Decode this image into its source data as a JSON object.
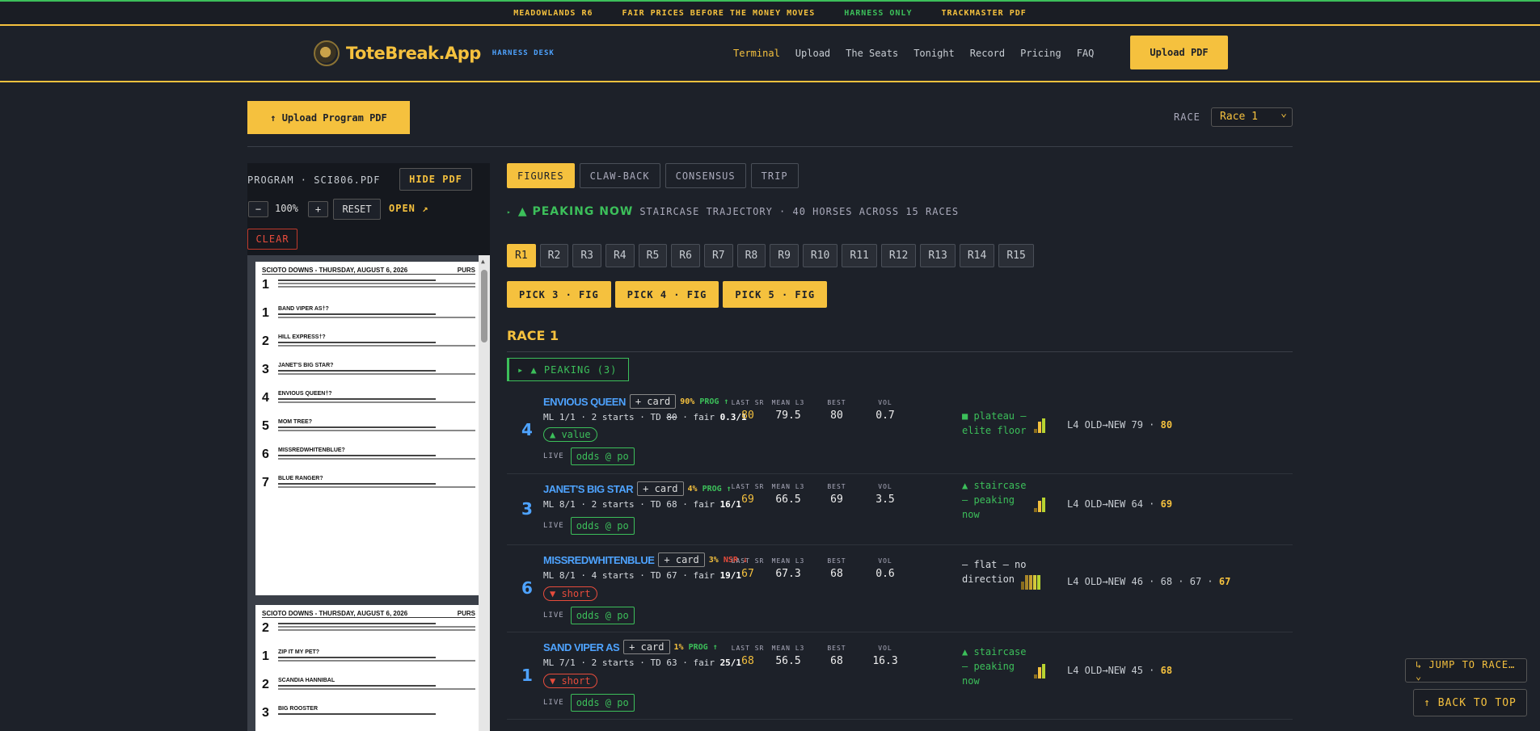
{
  "ticker": [
    "MEADOWLANDS R6",
    "FAIR PRICES BEFORE THE MONEY MOVES",
    "HARNESS ONLY",
    "TRACKMASTER PDF"
  ],
  "brand": {
    "name": "ToteBreak.App",
    "sub": "HARNESS DESK"
  },
  "nav": [
    "Terminal",
    "Upload",
    "The Seats",
    "Tonight",
    "Record",
    "Pricing",
    "FAQ"
  ],
  "upload_pdf": "Upload PDF",
  "upload_program": "↑ Upload Program PDF",
  "race_label": "RACE",
  "race_select": "Race 1",
  "pdf": {
    "title": "PROGRAM · SCI806.PDF",
    "hide": "HIDE PDF",
    "minus": "−",
    "zoom": "100%",
    "plus": "+",
    "reset": "RESET",
    "open": "OPEN ↗",
    "clear": "CLEAR",
    "page1_header": "SCIOTO DOWNS - THURSDAY, AUGUST 6, 2026",
    "page1_corner": "PURS",
    "page1_horses": [
      "BAND VIPER AS†?",
      "HILL EXPRESS†?",
      "JANET'S BIG STAR?",
      "ENVIOUS QUEEN†?",
      "MOM TREE?",
      "MISSREDWHITENBLUE?",
      "BLUE RANGER?"
    ],
    "page2_header": "SCIOTO DOWNS - THURSDAY, AUGUST 6, 2026",
    "page2_horses": [
      "ZIP IT MY PET?",
      "SCANDIA HANNIBAL",
      "BIG ROOSTER"
    ]
  },
  "tabs": [
    "FIGURES",
    "CLAW-BACK",
    "CONSENSUS",
    "TRIP"
  ],
  "peak_line": {
    "arrow": "▸",
    "label": "▲ PEAKING NOW",
    "desc": "STAIRCASE TRAJECTORY · 40 HORSES ACROSS 15 RACES"
  },
  "race_tabs": [
    "R1",
    "R2",
    "R3",
    "R4",
    "R5",
    "R6",
    "R7",
    "R8",
    "R9",
    "R10",
    "R11",
    "R12",
    "R13",
    "R14",
    "R15"
  ],
  "picks": [
    "PICK 3 · FIG",
    "PICK 4 · FIG",
    "PICK 5 · FIG"
  ],
  "race_title": "RACE 1",
  "peaking_group": "▸ ▲ PEAKING (3)",
  "stat_labels": {
    "last": "LAST SR",
    "mean": "MEAN L3",
    "best": "BEST",
    "vol": "VOL"
  },
  "live_label": "LIVE",
  "horses": [
    {
      "pp": "4",
      "name": "ENVIOUS QUEEN",
      "card": "+ card",
      "pct": "90%",
      "dir": "PROG ↑",
      "dir_color": "#3cbf5a",
      "ml_a": "ML 1/1 · 2 starts · TD ",
      "td": "80",
      "ml_b": " · fair ",
      "fair": "0.3/1",
      "badge": "▲ value",
      "badge_type": "v",
      "odds": "odds @ po",
      "last": "80",
      "mean": "79.5",
      "best": "80",
      "vol": "0.7",
      "traj": "■ plateau — elite floor",
      "traj_color": "g",
      "l4": "L4 OLD→NEW ",
      "l4_seq": "79 · ",
      "l4_last": "80"
    },
    {
      "pp": "3",
      "name": "JANET'S BIG STAR",
      "card": "+ card",
      "pct": "4%",
      "dir": "PROG ↑",
      "dir_color": "#3cbf5a",
      "ml_a": "ML 8/1 · 2 starts · TD ",
      "td": "68",
      "ml_b": " · fair ",
      "fair": "16/1",
      "badge": "",
      "badge_type": "",
      "odds": "odds @ po",
      "last": "69",
      "mean": "66.5",
      "best": "69",
      "vol": "3.5",
      "traj": "▲ staircase — peaking now",
      "traj_color": "g",
      "l4": "L4 OLD→NEW ",
      "l4_seq": "64 · ",
      "l4_last": "69"
    },
    {
      "pp": "6",
      "name": "MISSREDWHITENBLUE",
      "card": "+ card",
      "pct": "3%",
      "dir": "NSR ↓",
      "dir_color": "#e74c3c",
      "ml_a": "ML 8/1 · 4 starts · TD ",
      "td": "67",
      "ml_b": " · fair ",
      "fair": "19/1",
      "badge": "▼ short",
      "badge_type": "s",
      "odds": "odds @ po",
      "last": "67",
      "mean": "67.3",
      "best": "68",
      "vol": "0.6",
      "traj": "— flat — no direction",
      "traj_color": "w",
      "l4": "L4 OLD→NEW ",
      "l4_seq": "46 · 68 · 67 · ",
      "l4_last": "67"
    },
    {
      "pp": "1",
      "name": "SAND VIPER AS",
      "card": "+ card",
      "pct": "1%",
      "dir": "PROG ↑",
      "dir_color": "#3cbf5a",
      "ml_a": "ML 7/1 · 2 starts · TD ",
      "td": "63",
      "ml_b": " · fair ",
      "fair": "25/1",
      "badge": "▼ short",
      "badge_type": "s",
      "odds": "odds @ po",
      "last": "68",
      "mean": "56.5",
      "best": "68",
      "vol": "16.3",
      "traj": "▲ staircase — peaking now",
      "traj_color": "g",
      "l4": "L4 OLD→NEW ",
      "l4_seq": "45 · ",
      "l4_last": "68"
    }
  ],
  "jump": "↳ JUMP TO RACE… ⌄",
  "back_top": "↑ BACK TO TOP"
}
